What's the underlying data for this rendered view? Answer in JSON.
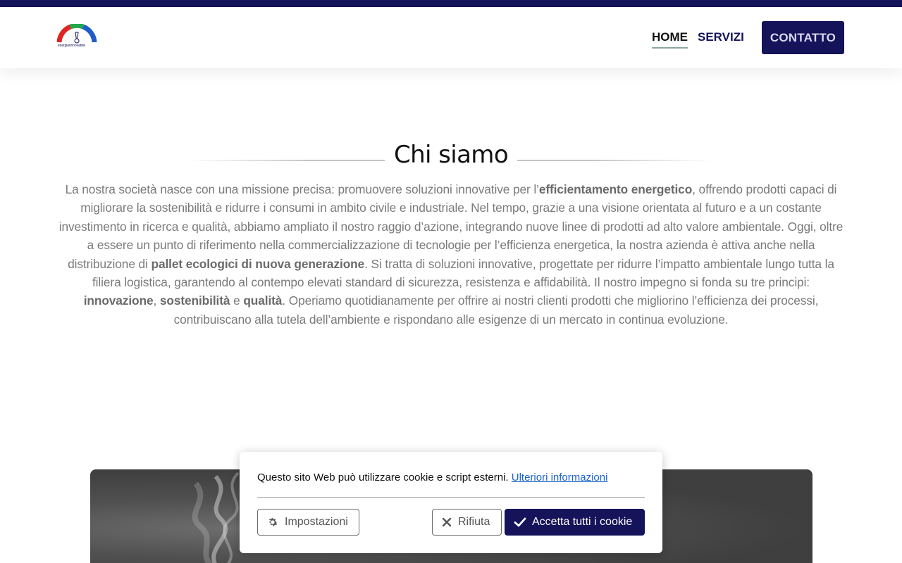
{
  "colors": {
    "brand": "#15135a",
    "link": "#1a64c8",
    "nav_underline": "#8aa89a"
  },
  "logo": {
    "text": "energiarinnovabile"
  },
  "nav": {
    "home_label": "HOME",
    "servizi_label": "SERVIZI",
    "contatto_label": "CONTATTO"
  },
  "section": {
    "title": "Chi siamo",
    "p1": "La nostra società nasce con una missione precisa: promuovere soluzioni innovative per l’",
    "b1": "efficientamento energetico",
    "p2": ", offrendo prodotti capaci di migliorare la sostenibilità e ridurre i consumi in ambito civile e industriale. Nel tempo, grazie a una visione orientata al futuro e a un costante investimento in ricerca e qualità, abbiamo ampliato il nostro raggio d’azione, integrando nuove linee di prodotti ad alto valore ambientale. Oggi, oltre a essere un punto di riferimento nella commercializzazione di tecnologie per l’efficienza energetica, la nostra azienda è attiva anche nella distribuzione di ",
    "b2": "pallet ecologici di nuova generazione",
    "p3": ". Si tratta di soluzioni innovative, progettate per ridurre l’impatto ambientale lungo tutta la filiera logistica, garantendo al contempo elevati standard di sicurezza, resistenza e affidabilità. Il nostro impegno si fonda su tre principi: ",
    "b3": "innovazione",
    "p4": ", ",
    "b4": "sostenibilità",
    "p5": " e ",
    "b5": "qualità",
    "p6": ". Operiamo quotidianamente per offrire ai nostri clienti prodotti che migliorino l’efficienza dei processi, contribuiscano alla tutela dell’ambiente e rispondano alle esigenze di un mercato in continua evoluzione."
  },
  "cookie": {
    "message": "Questo sito Web può utilizzare cookie e script esterni.",
    "link_label": "Ulteriori informazioni",
    "settings_label": "Impostazioni",
    "reject_label": "Rifiuta",
    "accept_label": "Accetta tutti i cookie",
    "icons": {
      "settings": "gear-icon",
      "reject": "close-icon",
      "accept": "check-icon"
    }
  }
}
